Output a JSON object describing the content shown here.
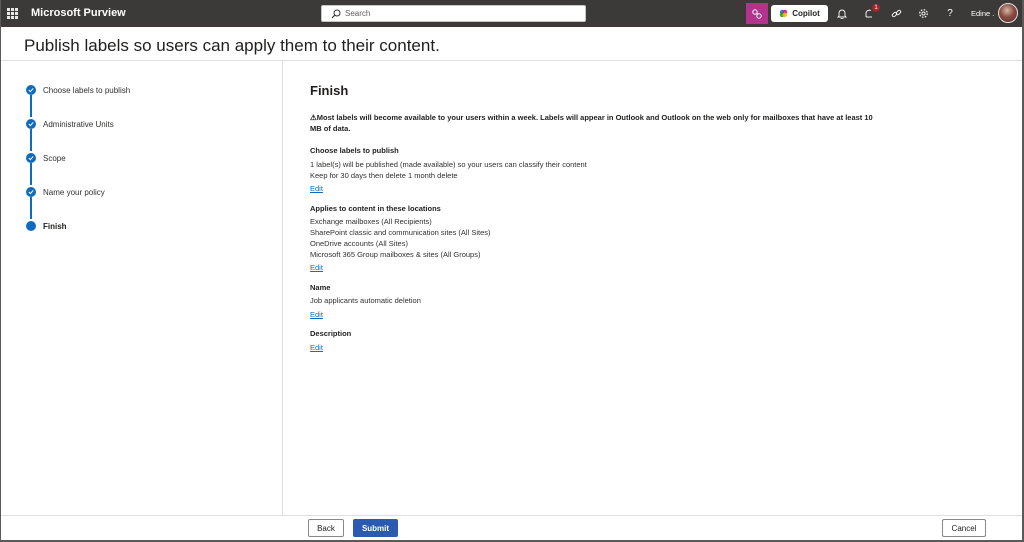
{
  "app": {
    "title": "Microsoft Purview",
    "search_placeholder": "Search",
    "copilot_label": "Copilot",
    "notification_count": "1",
    "user_name": "Edine ."
  },
  "page": {
    "title": "Publish labels so users can apply them to their content."
  },
  "steps": [
    {
      "label": "Choose labels to publish",
      "state": "completed"
    },
    {
      "label": "Administrative Units",
      "state": "completed"
    },
    {
      "label": "Scope",
      "state": "completed"
    },
    {
      "label": "Name your policy",
      "state": "completed"
    },
    {
      "label": "Finish",
      "state": "current"
    }
  ],
  "finish": {
    "heading": "Finish",
    "warning_icon": "⚠",
    "warning": "Most labels will become available to your users within a week. Labels will appear in Outlook and Outlook on the web only for mailboxes that have at least 10 MB of data.",
    "sections": {
      "labels": {
        "heading": "Choose labels to publish",
        "lines": [
          "1 label(s) will be published (made available) so your users can classify their content",
          "Keep for 30 days then delete 1 month delete"
        ],
        "edit": "Edit"
      },
      "locations": {
        "heading": "Applies to content in these locations",
        "lines": [
          "Exchange mailboxes (All Recipients)",
          "SharePoint classic and communication sites (All Sites)",
          "OneDrive accounts (All Sites)",
          "Microsoft 365 Group mailboxes & sites (All Groups)"
        ],
        "edit": "Edit"
      },
      "name": {
        "heading": "Name",
        "lines": [
          "Job applicants automatic deletion"
        ],
        "edit": "Edit"
      },
      "description": {
        "heading": "Description",
        "edit": "Edit"
      }
    }
  },
  "footer": {
    "back": "Back",
    "submit": "Submit",
    "cancel": "Cancel"
  },
  "colors": {
    "accent": "#0f6cbd",
    "submit": "#2b5bb0",
    "topbar": "#3b3a39",
    "copilot_tile": "#b4338f"
  },
  "icons": [
    "app-launcher-icon",
    "search-icon",
    "copilot-app-icon",
    "copilot-logo-icon",
    "bell-icon",
    "alert-badge-icon",
    "link-icon",
    "gear-icon",
    "help-icon",
    "checkmark-icon"
  ]
}
